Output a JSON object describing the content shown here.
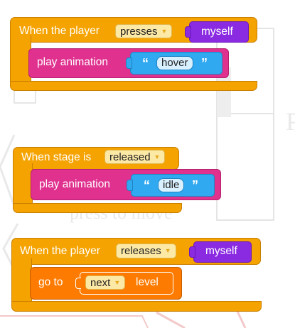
{
  "background": {
    "text": "press to move",
    "text_right": "P"
  },
  "blocks": [
    {
      "hat": {
        "label": "When the player",
        "dropdown": "presses",
        "target": "myself"
      },
      "statement": {
        "label": "play animation",
        "value": "hover",
        "open_quote": "“",
        "close_quote": "”"
      }
    },
    {
      "hat": {
        "label": "When stage is",
        "dropdown": "released"
      },
      "statement": {
        "label": "play animation",
        "value": "idle",
        "open_quote": "“",
        "close_quote": "”"
      }
    },
    {
      "hat": {
        "label": "When the player",
        "dropdown": "releases",
        "target": "myself"
      },
      "statement": {
        "label": "go to",
        "dropdown": "next",
        "suffix": "level"
      }
    }
  ],
  "colors": {
    "event": "#f5a300",
    "animation": "#e0318f",
    "control": "#fd7b00",
    "object": "#8a2be2",
    "text": "#30a9f0"
  }
}
